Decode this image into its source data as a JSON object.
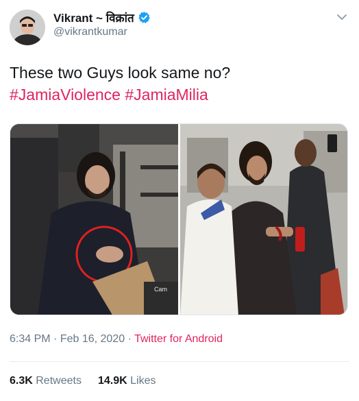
{
  "author": {
    "display_name": "Vikrant ~ विक्रांत",
    "handle": "@vikrantkumar",
    "verified": true
  },
  "tweet": {
    "text": "These two Guys look same no?",
    "hashtags": [
      "#JamiaViolence",
      "#JamiaMilia"
    ]
  },
  "media": {
    "left_caption": "Cam"
  },
  "meta": {
    "time": "6:34 PM",
    "separator": "·",
    "date": "Feb 16, 2020",
    "source": "Twitter for Android"
  },
  "stats": {
    "retweets_count": "6.3K",
    "retweets_label": "Retweets",
    "likes_count": "14.9K",
    "likes_label": "Likes"
  },
  "icons": {
    "verified": "verified-badge-icon",
    "menu": "chevron-down-icon"
  },
  "colors": {
    "hashtag": "#e0245e",
    "verified": "#1da1f2",
    "secondary_text": "#657786",
    "highlight_circle": "#e02020"
  }
}
